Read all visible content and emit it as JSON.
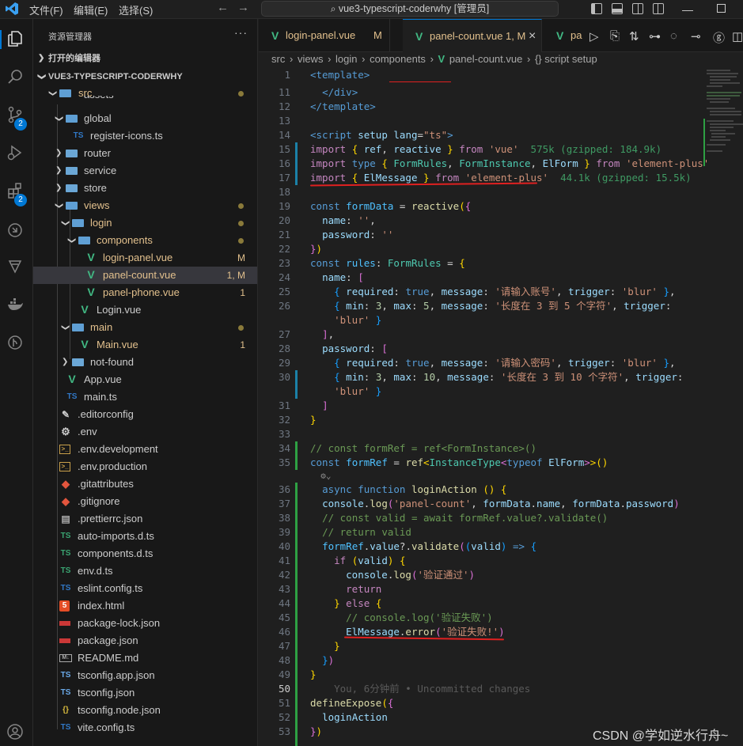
{
  "titlebar": {
    "menus": [
      "文件(F)",
      "编辑(E)",
      "选择(S)"
    ],
    "command_center": "vue3-typescript-coderwhy [管理员]"
  },
  "activity_bar": {
    "badges": {
      "source_control": "2",
      "extensions": "2"
    }
  },
  "sidebar": {
    "title": "资源管理器",
    "more": "···",
    "sections": {
      "open_editors": "打开的编辑器",
      "project": "VUE3-TYPESCRIPT-CODERWHY"
    },
    "tree": [
      {
        "label": "src",
        "status": "dot"
      },
      {
        "label": "assets",
        "status": ""
      },
      {
        "label": "global",
        "status": ""
      },
      {
        "label": "register-icons.ts",
        "icon_text": "TS",
        "status": ""
      },
      {
        "label": "router",
        "status": ""
      },
      {
        "label": "service",
        "status": ""
      },
      {
        "label": "store",
        "status": ""
      },
      {
        "label": "views",
        "status": "dot"
      },
      {
        "label": "login",
        "status": "dot"
      },
      {
        "label": "components",
        "status": "dot"
      },
      {
        "label": "login-panel.vue",
        "status": "M"
      },
      {
        "label": "panel-count.vue",
        "status": "1, M"
      },
      {
        "label": "panel-phone.vue",
        "status": "1"
      },
      {
        "label": "Login.vue",
        "status": ""
      },
      {
        "label": "main",
        "status": "dot"
      },
      {
        "label": "Main.vue",
        "status": "1"
      },
      {
        "label": "not-found",
        "status": ""
      },
      {
        "label": "App.vue",
        "status": ""
      },
      {
        "label": "main.ts",
        "icon_text": "TS",
        "status": ""
      },
      {
        "label": ".editorconfig",
        "status": ""
      },
      {
        "label": ".env",
        "status": ""
      },
      {
        "label": ".env.development",
        "status": ""
      },
      {
        "label": ".env.production",
        "status": ""
      },
      {
        "label": ".gitattributes",
        "status": ""
      },
      {
        "label": ".gitignore",
        "status": ""
      },
      {
        "label": ".prettierrc.json",
        "status": ""
      },
      {
        "label": "auto-imports.d.ts",
        "icon_text": "TS",
        "status": ""
      },
      {
        "label": "components.d.ts",
        "icon_text": "TS",
        "status": ""
      },
      {
        "label": "env.d.ts",
        "icon_text": "TS",
        "status": ""
      },
      {
        "label": "eslint.config.ts",
        "icon_text": "TS",
        "status": ""
      },
      {
        "label": "index.html",
        "icon_text": "5",
        "status": ""
      },
      {
        "label": "package-lock.json",
        "status": ""
      },
      {
        "label": "package.json",
        "status": ""
      },
      {
        "label": "README.md",
        "icon_text": "M↓",
        "status": ""
      },
      {
        "label": "tsconfig.app.json",
        "icon_text": "TS",
        "status": ""
      },
      {
        "label": "tsconfig.json",
        "icon_text": "TS",
        "status": ""
      },
      {
        "label": "tsconfig.node.json",
        "icon_text": "{}",
        "status": ""
      },
      {
        "label": "vite.config.ts",
        "icon_text": "TS",
        "status": ""
      }
    ]
  },
  "tabs": [
    {
      "label": "login-panel.vue",
      "mark": "M"
    },
    {
      "label": "panel-count.vue",
      "mark": "1, M",
      "close": "×"
    },
    {
      "label": "pa",
      "mark": ""
    }
  ],
  "breadcrumb": [
    "src",
    "views",
    "login",
    "components",
    "panel-count.vue",
    "{} script setup"
  ],
  "editor": {
    "lines": {
      "l1": "1",
      "l11": "11",
      "l12": "12",
      "l13": "13",
      "l14": "14",
      "l15": "15",
      "l16": "16",
      "l17": "17",
      "l18": "18",
      "l19": "19",
      "l20": "20",
      "l21": "21",
      "l22": "22",
      "l23": "23",
      "l24": "24",
      "l25": "25",
      "l26": "26",
      "l27": "27",
      "l28": "28",
      "l29": "29",
      "l30": "30",
      "l31": "31",
      "l32": "32",
      "l33": "33",
      "l34": "34",
      "l35": "35",
      "l36": "36",
      "l37": "37",
      "l38": "38",
      "l39": "39",
      "l40": "40",
      "l41": "41",
      "l42": "42",
      "l43": "43",
      "l44": "44",
      "l45": "45",
      "l46": "46",
      "l47": "47",
      "l48": "48",
      "l49": "49",
      "l50": "50",
      "l51": "51",
      "l52": "52",
      "l53": "53"
    },
    "import_cost": {
      "vue": "575k (gzipped: 184.9k)",
      "element_plus": "44.1k (gzipped: 15.5k)"
    },
    "blame": "You, 6分钟前 • Uncommitted changes",
    "strings": {
      "msg_account": "'请输入账号'",
      "msg_len_account": "'长度在 3 到 5 个字符'",
      "msg_password": "'请输入密码'",
      "msg_len_password": "'长度在 3 到 10 个字符'",
      "pass": "'验证通过'",
      "fail_comment": "'验证失败'",
      "fail": "'验证失败!'"
    }
  },
  "watermark": "CSDN @学如逆水行舟~",
  "colors": {
    "accent": "#0078d4",
    "annotation_red": "#e02020"
  }
}
